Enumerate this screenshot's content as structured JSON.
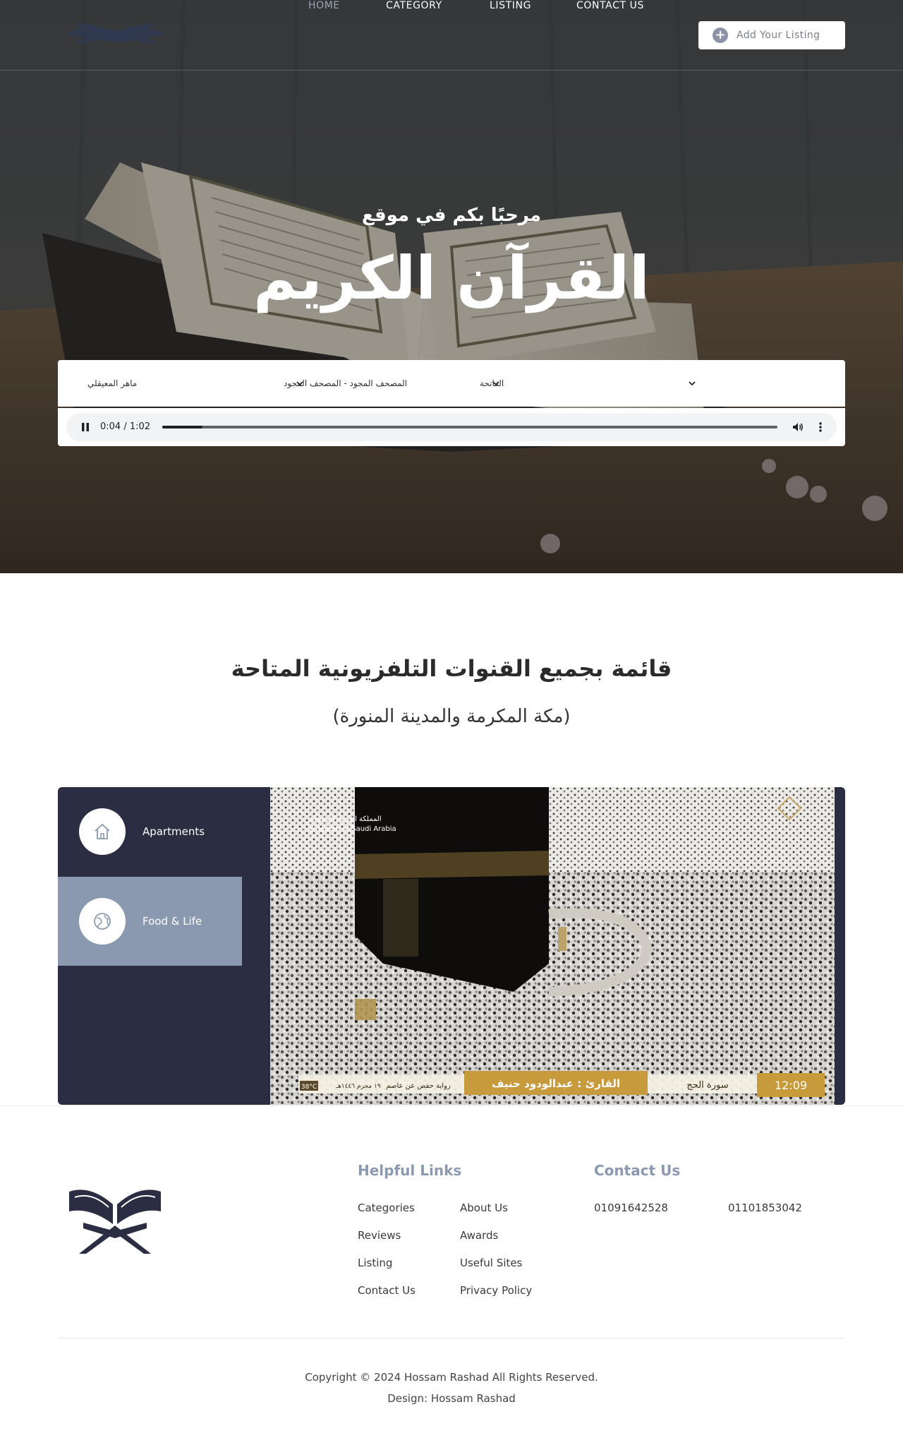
{
  "nav": {
    "items": [
      {
        "label": "HOME",
        "active": true
      },
      {
        "label": "CATEGORY",
        "active": false
      },
      {
        "label": "LISTING",
        "active": false
      },
      {
        "label": "CONTACT US",
        "active": false
      }
    ],
    "cta_label": "Add Your Listing",
    "cta_icon": "plus-circle-icon"
  },
  "hero": {
    "subtitle": "مرحبًا بكم في موقع",
    "title": "القرآن الكريم",
    "selects": {
      "reciter": "ماهر المعيقلي",
      "mushaf": "المصحف المجود - المصحف المجود",
      "surah": "الفاتحة"
    },
    "player": {
      "time": "0:04 / 1:02",
      "progress": 0.065
    }
  },
  "channels": {
    "title": "قائمة بجميع القنوات التلفزيونية المتاحة",
    "subtitle": "(مكة المكرمة والمدينة المنورة)",
    "tabs": [
      {
        "label": "Apartments",
        "icon": "home-icon",
        "active": false
      },
      {
        "label": "Food & Life",
        "icon": "globe-icon",
        "active": true
      }
    ],
    "video_overlay": {
      "banner_line1": "المملكة العربية السعودية",
      "banner_line2": "Kingdom of Saudi Arabia",
      "reader": "القارئ : عبدالودود حنيف",
      "surah": "سورة الحج",
      "riwaya": "رواية حفص عن عاصم",
      "date": "١٩ محرم ١٤٤٦هـ",
      "temp": "38°C",
      "clock": "12:09"
    }
  },
  "footer": {
    "helpful_title": "Helpful Links",
    "links_col1": [
      "Categories",
      "Reviews",
      "Listing",
      "Contact Us"
    ],
    "links_col2": [
      "About Us",
      "Awards",
      "Useful Sites",
      "Privacy Policy"
    ],
    "contact_title": "Contact Us",
    "phone1": "01091642528",
    "phone2": "01101853042",
    "copyright": "Copyright © 2024 Hossam Rashad All Rights Reserved.",
    "design": "Design: Hossam Rashad"
  },
  "colors": {
    "accent": "#8b99b0",
    "panel": "#2b2d42",
    "nav_active": "#9aa4b6"
  }
}
